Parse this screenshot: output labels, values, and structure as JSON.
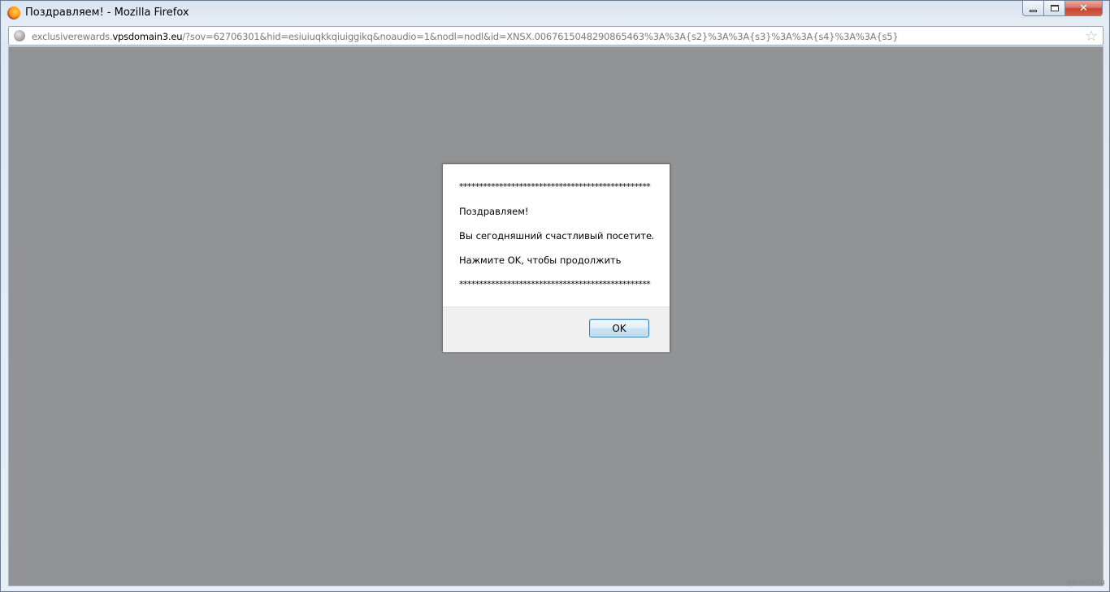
{
  "window": {
    "title": "Поздравляем! - Mozilla Firefox",
    "controls": {
      "minimize": "",
      "maximize": "",
      "close": "✕"
    }
  },
  "urlbar": {
    "prefix": "exclusiverewards.",
    "domain": "vpsdomain3.eu",
    "path": "/?sov=62706301&hid=esiuiuqkkqiuiggikq&noaudio=1&nodl=nodl&id=XNSX.0067615048290865463%3A%3A{s2}%3A%3A{s3}%3A%3A{s4}%3A%3A{s5}"
  },
  "dialog": {
    "stars_top": "************************************************",
    "line1": "Поздравляем!",
    "line2": "Вы сегодняшний счастливый посетитель.",
    "line3": "Нажмите OK, чтобы продолжить",
    "stars_bottom": "************************************************",
    "ok_label": "OK"
  },
  "watermark": "pikabu.ru"
}
